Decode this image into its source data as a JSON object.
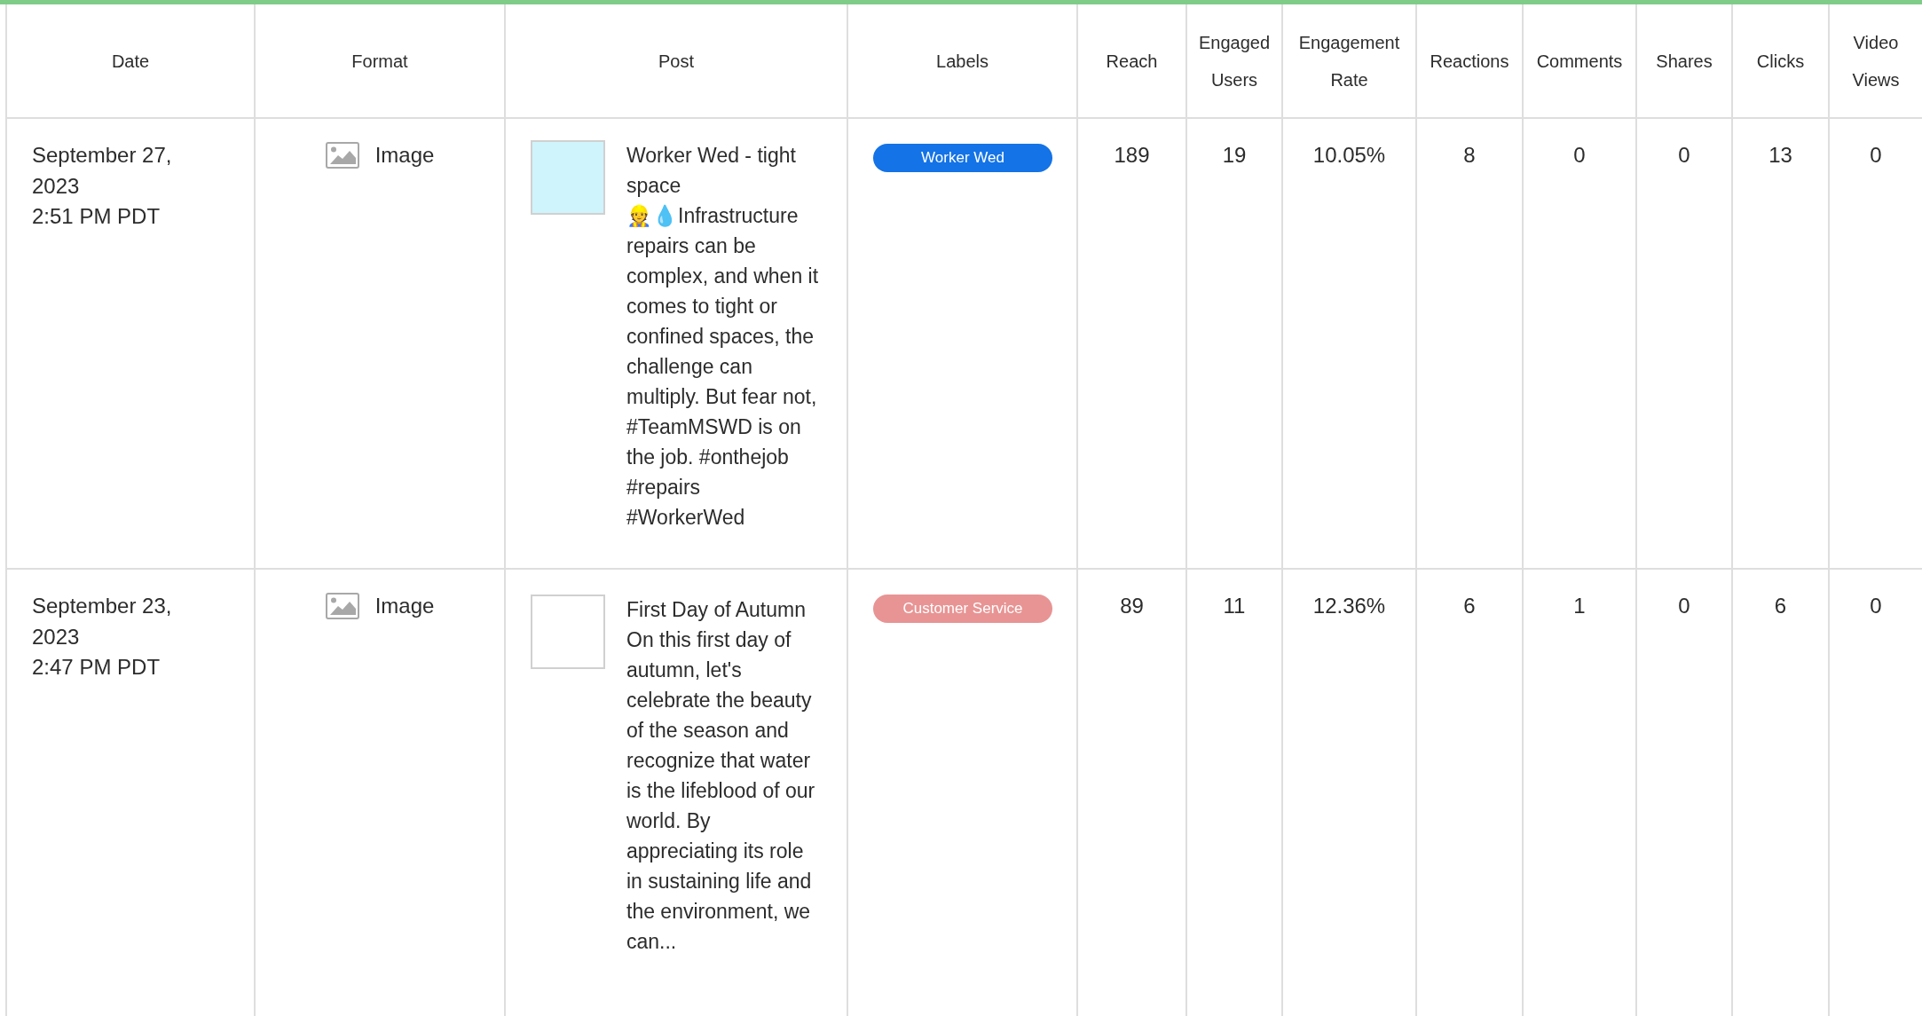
{
  "table": {
    "columns": [
      "Date",
      "Format",
      "Post",
      "Labels",
      "Reach",
      "Engaged Users",
      "Engagement Rate",
      "Reactions",
      "Comments",
      "Shares",
      "Clicks",
      "Video Views"
    ],
    "rows": [
      {
        "date": "September 27, 2023",
        "time": "2:51 PM PDT",
        "format": "Image",
        "post_title": "Worker Wed - tight space",
        "post_text": "👷💧Infrastructure repairs can be complex, and when it comes to tight or confined spaces, the challenge can multiply. But fear not, #TeamMSWD is on the job. #onthejob #repairs #WorkerWed",
        "labels": [
          {
            "text": "Worker Wed",
            "color": "#1473e6"
          }
        ],
        "metrics": [
          "189",
          "19",
          "10.05%",
          "8",
          "0",
          "0",
          "13",
          "0"
        ]
      },
      {
        "date": "September 23, 2023",
        "time": "2:47 PM PDT",
        "format": "Image",
        "post_title": "First Day of Autumn",
        "post_text": "On this first day of autumn, let's celebrate the beauty of the season and recognize that water is the lifeblood of our world. By appreciating its role in sustaining life and the environment, we can...",
        "labels": [
          {
            "text": "Customer Service",
            "color": "#e89494"
          }
        ],
        "metrics": [
          "89",
          "11",
          "12.36%",
          "6",
          "1",
          "0",
          "6",
          "0"
        ]
      }
    ]
  }
}
